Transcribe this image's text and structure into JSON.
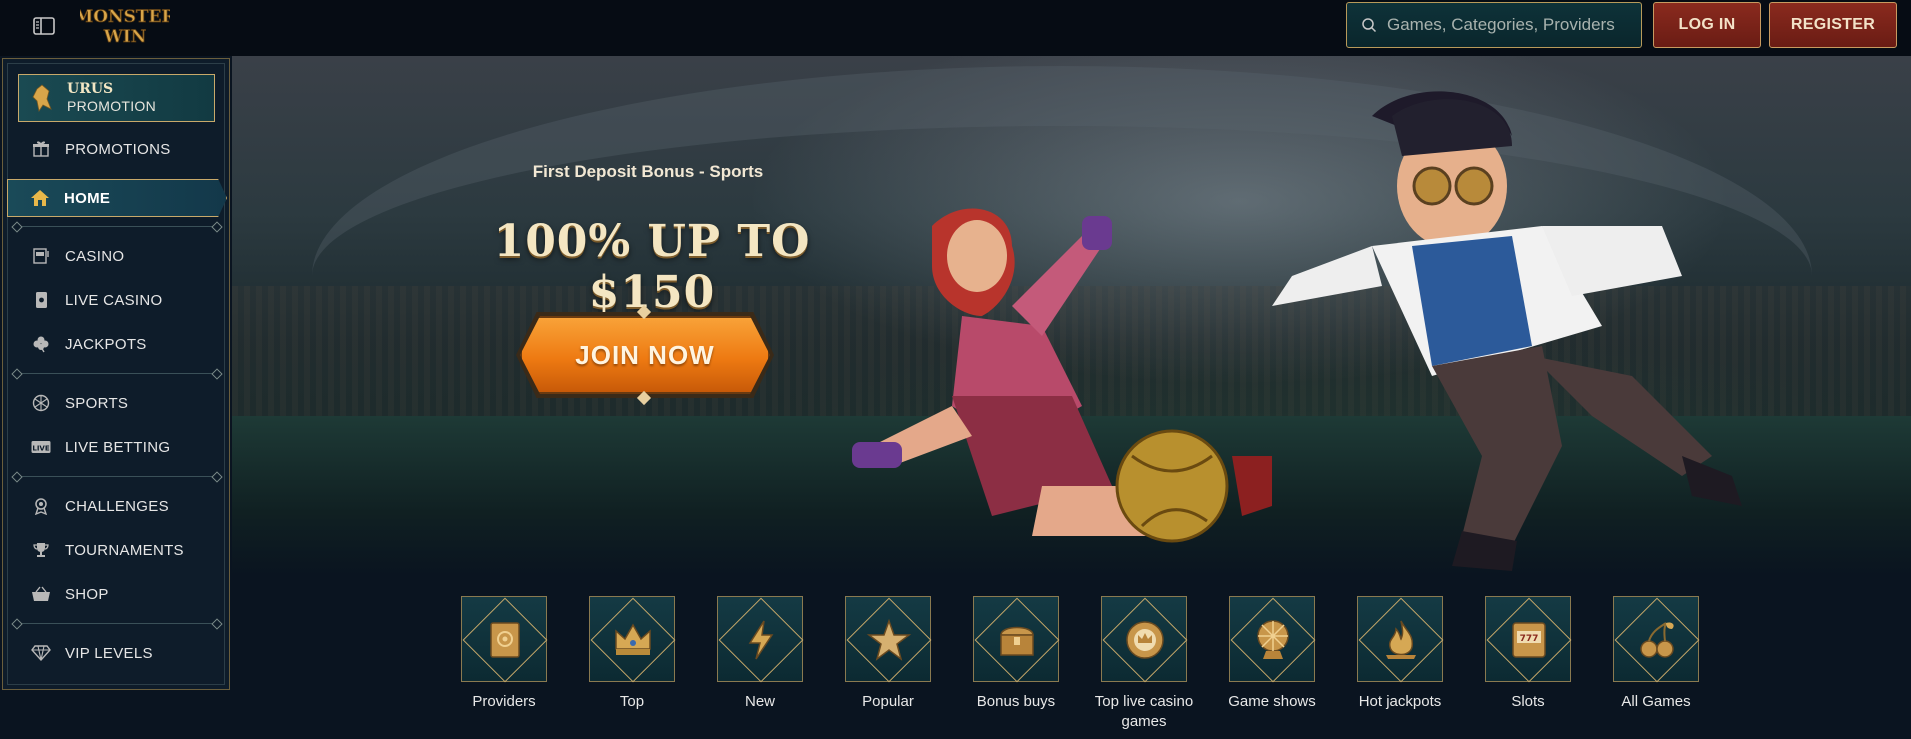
{
  "header": {
    "logo_text_line1": "MONSTER",
    "logo_text_line2": "WIN",
    "search_placeholder": "Games, Categories, Providers",
    "login_label": "LOG IN",
    "register_label": "REGISTER"
  },
  "sidebar": {
    "promo_card": {
      "line1": "URUS",
      "line2": "PROMOTION"
    },
    "items": [
      {
        "label": "PROMOTIONS",
        "icon": "gift-icon"
      },
      {
        "label": "HOME",
        "icon": "home-icon",
        "active": true
      },
      {
        "label": "CASINO",
        "icon": "slot-machine-icon"
      },
      {
        "label": "LIVE CASINO",
        "icon": "playing-card-icon"
      },
      {
        "label": "JACKPOTS",
        "icon": "clover-icon"
      },
      {
        "label": "SPORTS",
        "icon": "ball-icon"
      },
      {
        "label": "LIVE BETTING",
        "icon": "live-badge-icon"
      },
      {
        "label": "CHALLENGES",
        "icon": "medal-icon"
      },
      {
        "label": "TOURNAMENTS",
        "icon": "trophy-icon"
      },
      {
        "label": "SHOP",
        "icon": "basket-icon"
      },
      {
        "label": "VIP LEVELS",
        "icon": "diamond-icon"
      }
    ]
  },
  "hero": {
    "subtitle": "First Deposit Bonus - Sports",
    "headline": "100% UP TO $150",
    "cta_label": "JOIN NOW"
  },
  "categories": [
    {
      "label": "Providers",
      "icon": "book-gear-icon"
    },
    {
      "label": "Top",
      "icon": "crown-icon"
    },
    {
      "label": "New",
      "icon": "lightning-icon"
    },
    {
      "label": "Popular",
      "icon": "star-icon"
    },
    {
      "label": "Bonus buys",
      "icon": "chest-icon"
    },
    {
      "label": "Top live casino games",
      "icon": "chip-crown-icon"
    },
    {
      "label": "Game shows",
      "icon": "wheel-icon"
    },
    {
      "label": "Hot jackpots",
      "icon": "flame-icon"
    },
    {
      "label": "Slots",
      "icon": "slot-777-icon"
    },
    {
      "label": "All Games",
      "icon": "cherries-icon"
    }
  ],
  "colors": {
    "accent_gold": "#c8a96a",
    "cta_orange": "#ee7a12",
    "button_red": "#7a2418",
    "sidebar_bg": "#0e1c2a",
    "search_bg": "#0e3239"
  }
}
